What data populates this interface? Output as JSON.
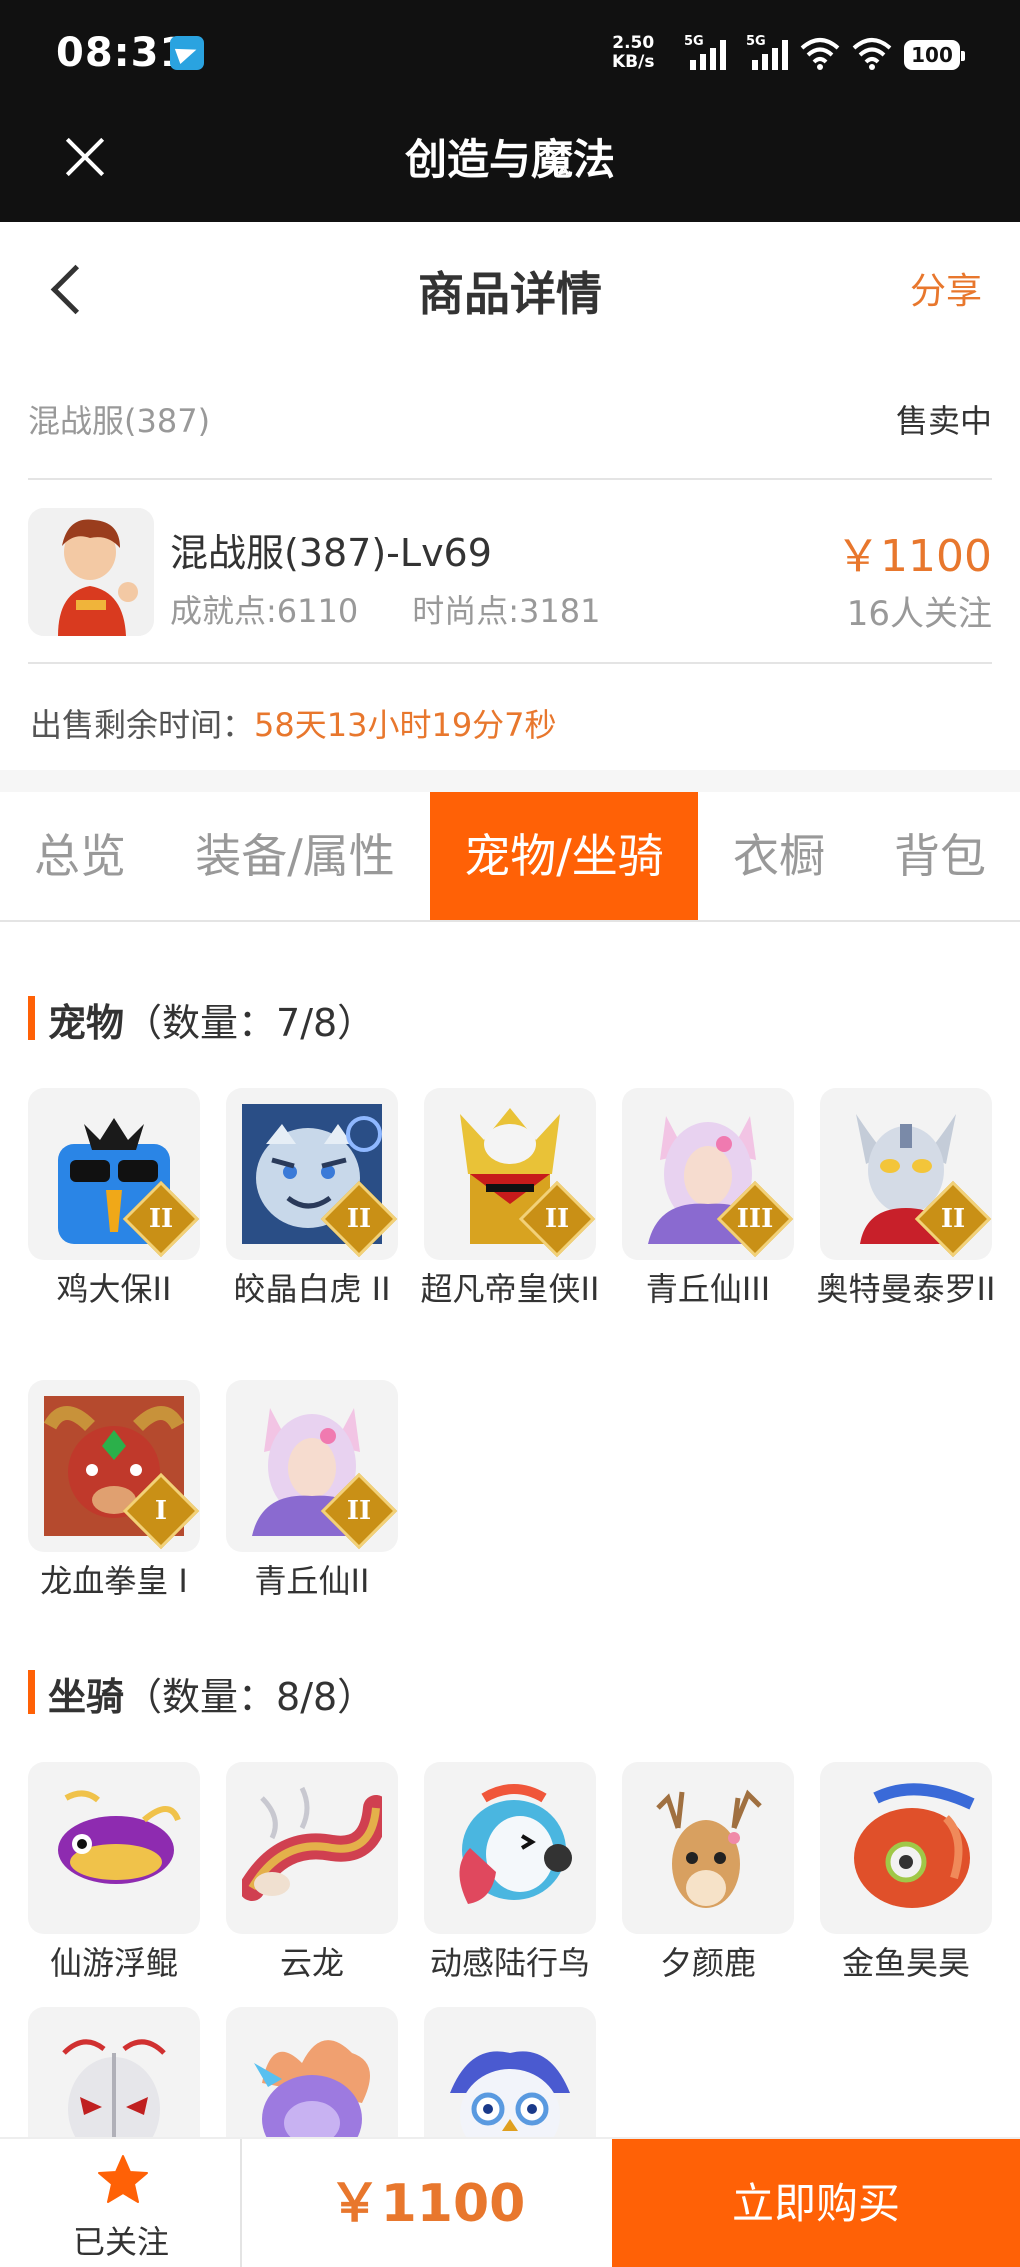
{
  "status_bar": {
    "time": "08:31",
    "net_speed_value": "2.50",
    "net_speed_unit": "KB/s",
    "signal1_label": "5G",
    "signal2_label": "5G",
    "battery": "100"
  },
  "app_bar": {
    "title": "创造与魔法"
  },
  "nav": {
    "title": "商品详情",
    "share_label": "分享"
  },
  "listing": {
    "server": "混战服(387)",
    "status": "售卖中",
    "name": "混战服(387)-Lv69",
    "achievement": "成就点:6110",
    "fashion": "时尚点:3181",
    "price": "￥1100",
    "followers": "16人关注",
    "remaining_label": "出售剩余时间：",
    "remaining_value": "58天13小时19分7秒"
  },
  "tabs": [
    {
      "label": "总览",
      "active": false
    },
    {
      "label": "装备/属性",
      "active": false
    },
    {
      "label": "宠物/坐骑",
      "active": true
    },
    {
      "label": "衣橱",
      "active": false
    },
    {
      "label": "背包",
      "active": false
    }
  ],
  "pets": {
    "title": "宠物",
    "count": "（数量：7/8）",
    "items": [
      {
        "name": "鸡大保II",
        "rank": "II",
        "icon": "blue-chicken-icon"
      },
      {
        "name": "皎晶白虎 II",
        "rank": "II",
        "icon": "white-tiger-icon"
      },
      {
        "name": "超凡帝皇侠II",
        "rank": "II",
        "icon": "golden-armor-icon"
      },
      {
        "name": "青丘仙III",
        "rank": "III",
        "icon": "fox-fairy-icon"
      },
      {
        "name": "奥特曼泰罗II",
        "rank": "II",
        "icon": "ultraman-icon"
      },
      {
        "name": "龙血拳皇 I",
        "rank": "I",
        "icon": "red-bull-icon"
      },
      {
        "name": "青丘仙II",
        "rank": "II",
        "icon": "fox-fairy-icon"
      }
    ]
  },
  "mounts": {
    "title": "坐骑",
    "count": "（数量：8/8）",
    "items": [
      {
        "name": "仙游浮鲲",
        "icon": "flying-fish-icon"
      },
      {
        "name": "云龙",
        "icon": "cloud-dragon-icon"
      },
      {
        "name": "动感陆行鸟",
        "icon": "headphone-bird-icon"
      },
      {
        "name": "夕颜鹿",
        "icon": "deer-icon"
      },
      {
        "name": "金鱼昊昊",
        "icon": "goldfish-icon"
      },
      {
        "name": "",
        "icon": "silver-mask-icon"
      },
      {
        "name": "",
        "icon": "purple-dragon-icon"
      },
      {
        "name": "",
        "icon": "snow-owl-icon"
      }
    ]
  },
  "bottom": {
    "follow_label": "已关注",
    "price": "￥1100",
    "buy_label": "立即购买"
  },
  "colors": {
    "accent": "#ff6106",
    "price": "#e8772d",
    "rank_badge": "#c99016"
  }
}
